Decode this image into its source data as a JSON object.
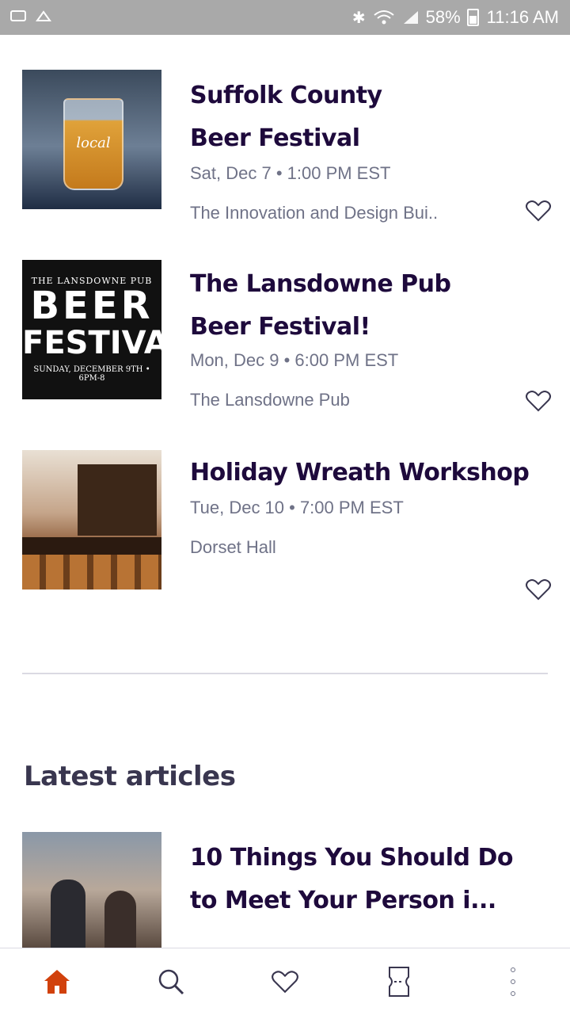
{
  "status_bar": {
    "battery": "58%",
    "time": "11:16 AM"
  },
  "events": [
    {
      "title": "Suffolk County Beer Festival",
      "date": "Sat, Dec 7 • 1:00 PM EST",
      "venue": "The Innovation and Design Bui..",
      "image_icon": "beer-glass-image"
    },
    {
      "title": "The Lansdowne Pub Beer Festival!",
      "date": "Mon, Dec 9 • 6:00 PM EST",
      "venue": "The Lansdowne Pub",
      "image_icon": "beer-festival-poster-image",
      "poster": {
        "line1": "THE LANSDOWNE PUB",
        "line2": "BEER",
        "line3": "FESTIVAL",
        "line4": "SUNDAY, DECEMBER 9TH • 6PM-8"
      }
    },
    {
      "title": "Holiday Wreath Workshop",
      "date": "Tue, Dec 10 • 7:00 PM EST",
      "venue": "Dorset Hall",
      "image_icon": "bar-interior-image"
    }
  ],
  "glass_text": "local",
  "section": {
    "title": "Latest articles"
  },
  "articles": [
    {
      "title": "10 Things You Should Do to Meet Your Person i...",
      "image_icon": "couple-running-image"
    }
  ],
  "bottom_nav": [
    {
      "icon": "home-icon",
      "active": true
    },
    {
      "icon": "search-icon",
      "active": false
    },
    {
      "icon": "heart-icon",
      "active": false
    },
    {
      "icon": "ticket-icon",
      "active": false
    },
    {
      "icon": "more-icon",
      "active": false
    }
  ],
  "colors": {
    "title": "#1e0a3c",
    "meta": "#6f7287",
    "home_active": "#d1410c",
    "status_bar": "#a9a9a9"
  }
}
